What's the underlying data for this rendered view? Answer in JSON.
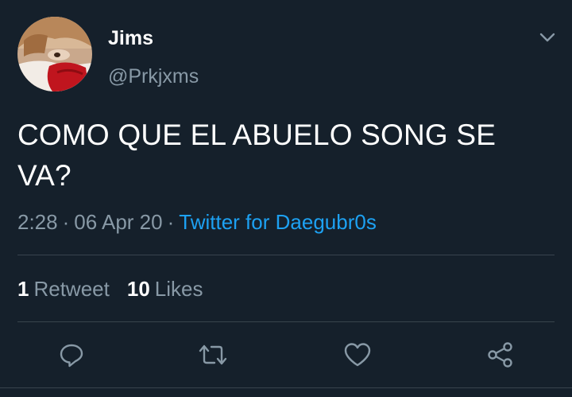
{
  "user": {
    "display_name": "Jims",
    "handle": "@Prkjxms",
    "avatar_icon": "profile-photo"
  },
  "tweet": {
    "text": "COMO QUE EL ABUELO SONG SE VA?",
    "time": "2:28",
    "separator": "·",
    "date": "06 Apr 20",
    "source": "Twitter for Daegubr0s"
  },
  "stats": {
    "retweets_count": "1",
    "retweets_label": "Retweet",
    "likes_count": "10",
    "likes_label": "Likes"
  },
  "actions": {
    "reply_icon": "reply-icon",
    "retweet_icon": "retweet-icon",
    "like_icon": "heart-icon",
    "share_icon": "share-icon"
  },
  "colors": {
    "background": "#15202b",
    "text": "#ffffff",
    "secondary": "#8899a6",
    "accent": "#1da1f2",
    "divider": "#38444d"
  }
}
